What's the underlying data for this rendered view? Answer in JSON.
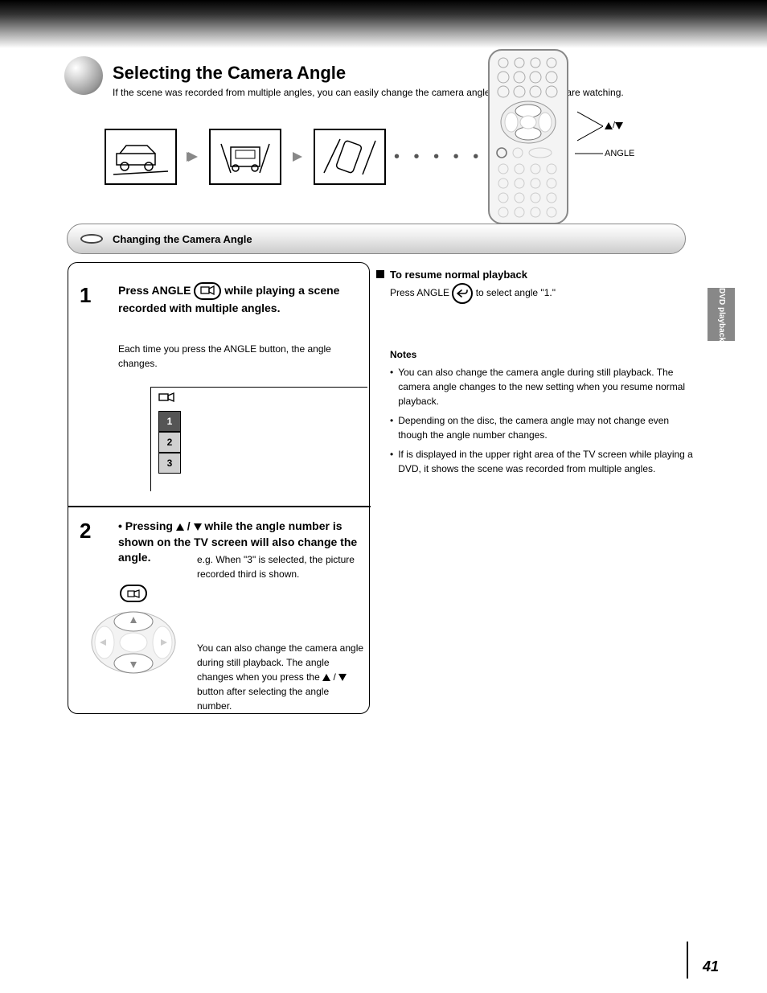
{
  "header": {
    "title": "Selecting the Camera Angle",
    "subtitle": "If the scene was recorded from multiple angles, you can easily change the camera angle of the scene you are watching."
  },
  "remote": {
    "lead1_lines": [
      "",
      "/"
    ],
    "lead1_full": "▲/▼",
    "lead2": "ANGLE"
  },
  "pill": {
    "text": "Changing the Camera Angle"
  },
  "step1": {
    "num": "1",
    "head_before": "Press ANGLE",
    "head_after": " while playing a scene recorded with multiple angles.",
    "body": "Each time you press the ANGLE button, the angle changes.",
    "osd": {
      "r1": "1",
      "r2": "2",
      "r3": "3"
    }
  },
  "step2": {
    "num": "2",
    "head_before": "• Pressing ",
    "head_sep": " / ",
    "head_after": " while the angle number is shown on the TV screen will also change the angle.",
    "body1": "e.g. When \"3\" is selected, the picture recorded third is shown.",
    "body2_before": "You can also change the camera angle during still playback. The angle changes when you press the ",
    "body2_after": " button after selecting the angle number."
  },
  "notes": {
    "heading": "To resume normal playback",
    "line1_before": "Press ANGLE ",
    "line1_after": " to select angle \"1.\"",
    "notes_label": "Notes",
    "bullets": [
      "You can also change the camera angle during still playback. The camera angle changes to the new setting when you resume normal playback.",
      "Depending on the disc, the camera angle may not change even though the angle number changes.",
      "If        is displayed in the upper right area of the TV screen while playing a DVD, it shows the scene was recorded from multiple angles."
    ]
  },
  "sidetab": "DVD playback",
  "page": "41",
  "footer_id": ""
}
